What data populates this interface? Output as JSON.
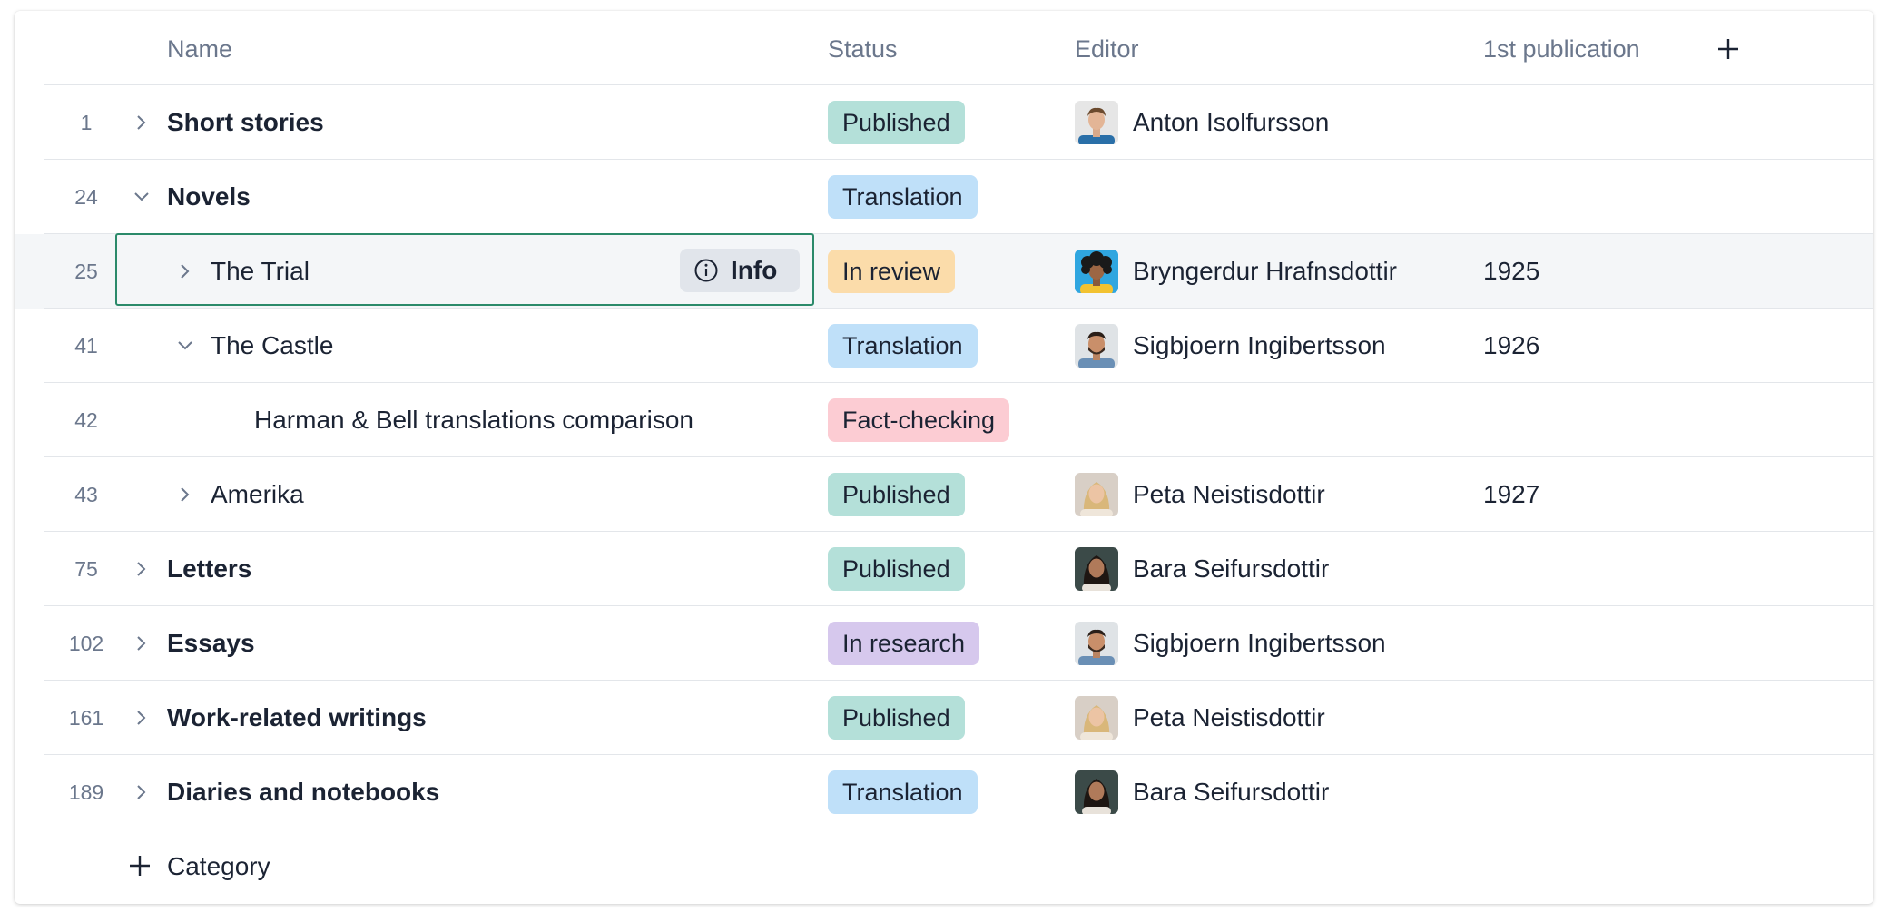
{
  "columns": {
    "name": "Name",
    "status": "Status",
    "editor": "Editor",
    "first_publication": "1st publication"
  },
  "colors": {
    "published": "#b4e0d9",
    "translation": "#bfe0f9",
    "in_review": "#fbdcaa",
    "fact_checking": "#fcccd3",
    "in_research": "#d6c8ed",
    "focus_border": "#2b8a6a",
    "selected_row": "#f4f6f8"
  },
  "rows": [
    {
      "num": "1",
      "name": "Short stories",
      "status": "Published",
      "editor": "Anton Isolfursson",
      "year": ""
    },
    {
      "num": "24",
      "name": "Novels",
      "status": "Translation",
      "editor": "",
      "year": ""
    },
    {
      "num": "25",
      "name": "The Trial",
      "status": "In review",
      "editor": "Bryngerdur Hrafnsdottir",
      "year": "1925"
    },
    {
      "num": "41",
      "name": "The Castle",
      "status": "Translation",
      "editor": "Sigbjoern Ingibertsson",
      "year": "1926"
    },
    {
      "num": "42",
      "name": "Harman & Bell translations comparison",
      "status": "Fact-checking",
      "editor": "",
      "year": ""
    },
    {
      "num": "43",
      "name": "Amerika",
      "status": "Published",
      "editor": "Peta Neistisdottir",
      "year": "1927"
    },
    {
      "num": "75",
      "name": "Letters",
      "status": "Published",
      "editor": "Bara Seifursdottir",
      "year": ""
    },
    {
      "num": "102",
      "name": "Essays",
      "status": "In research",
      "editor": "Sigbjoern Ingibertsson",
      "year": ""
    },
    {
      "num": "161",
      "name": "Work-related writings",
      "status": "Published",
      "editor": "Peta Neistisdottir",
      "year": ""
    },
    {
      "num": "189",
      "name": "Diaries and notebooks",
      "status": "Translation",
      "editor": "Bara Seifursdottir",
      "year": ""
    }
  ],
  "info_button": {
    "label": "Info",
    "icon": "info-icon"
  },
  "footer": {
    "add_label": "Category",
    "icon": "plus-icon"
  },
  "add_column_icon": "plus-icon"
}
